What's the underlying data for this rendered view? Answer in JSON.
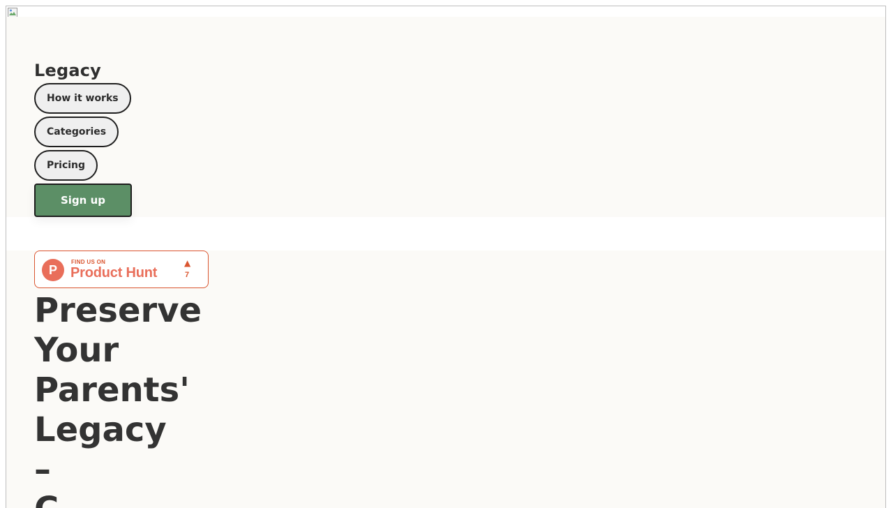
{
  "header": {
    "logo": "Legacy",
    "nav": [
      {
        "label": "How it works"
      },
      {
        "label": "Categories"
      },
      {
        "label": "Pricing"
      }
    ],
    "signup_label": "Sign up"
  },
  "product_hunt": {
    "small_text": "FIND US ON",
    "name": "Product Hunt",
    "letter": "P",
    "arrow": "▲",
    "count": "7"
  },
  "hero": {
    "title_lines": [
      "Preserve",
      "Your",
      "Parents'",
      "Legacy",
      "–",
      "C"
    ]
  },
  "colors": {
    "page_bg": "#fbfaf7",
    "accent_green": "#5c8f66",
    "product_hunt_orange": "#da552f"
  }
}
